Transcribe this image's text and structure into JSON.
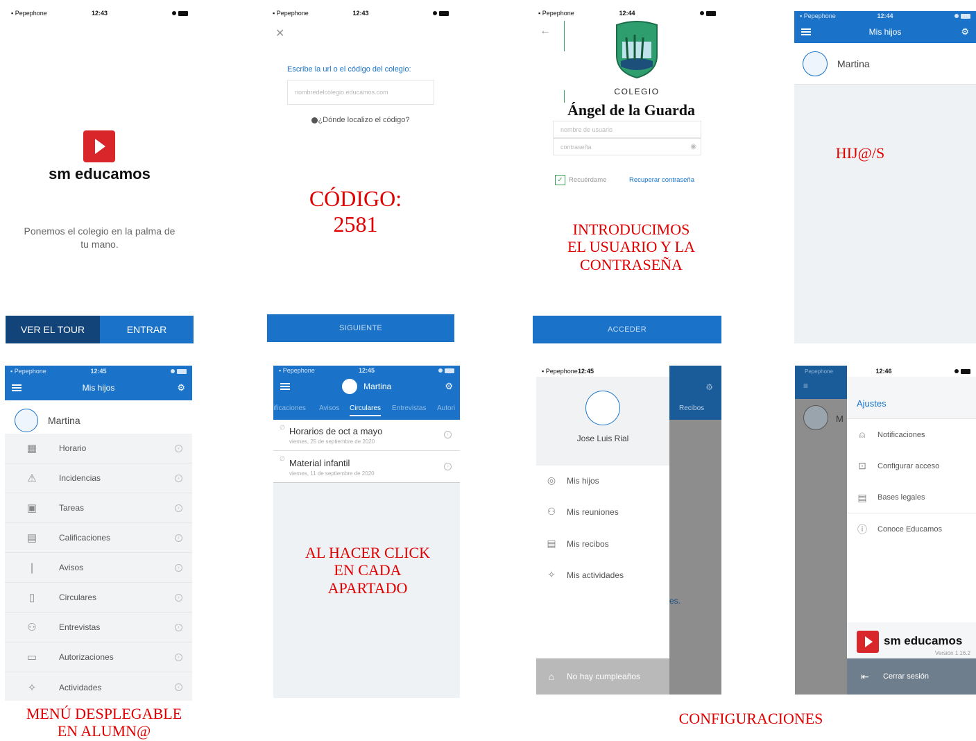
{
  "status": {
    "carrier": "Pepephone",
    "s1_time": "12:43",
    "s2_time": "12:43",
    "s3_time": "12:44",
    "s4_time": "12:44",
    "s5_time": "12:45",
    "s6_time": "12:45",
    "s7_time": "12:45",
    "s8_time": "12:46"
  },
  "s1": {
    "brand": "sm educamos",
    "tagline": "Ponemos el colegio en la palma de tu mano.",
    "tour_label": "VER EL TOUR",
    "enter_label": "ENTRAR"
  },
  "s2": {
    "close_glyph": "✕",
    "prompt": "Escribe la url o el código del colegio:",
    "url_placeholder": "nombredelcolegio.educamos.com",
    "help": "¿Dónde localizo el código?",
    "next_label": "SIGUIENTE",
    "note_line1": "CÓDIGO:",
    "note_line2": "2581"
  },
  "s3": {
    "back_glyph": "←",
    "school_small": "COLEGIO",
    "school_name": "Ángel de la Guarda",
    "user_placeholder": "nombre de usuario",
    "pass_placeholder": "contraseña",
    "remember": "Recuérdame",
    "recover": "Recuperar contraseña",
    "access_label": "ACCEDER",
    "note": [
      "INTRODUCIMOS",
      "EL USUARIO Y LA",
      "CONTRASEÑA"
    ]
  },
  "s4": {
    "title": "Mis hijos",
    "child": "Martina",
    "note": "HIJ@/S"
  },
  "s5": {
    "title": "Mis hijos",
    "child": "Martina",
    "items": [
      "Horario",
      "Incidencias",
      "Tareas",
      "Calificaciones",
      "Avisos",
      "Circulares",
      "Entrevistas",
      "Autorizaciones",
      "Actividades"
    ],
    "icons": [
      "calendar-icon",
      "warning-icon",
      "calculator-icon",
      "grades-icon",
      "notice-icon",
      "document-icon",
      "interviews-icon",
      "authorization-icon",
      "activities-icon"
    ],
    "note": [
      "MENÚ DESPLEGABLE",
      "EN ALUMN@"
    ]
  },
  "s6": {
    "child": "Martina",
    "tabs": [
      "lificaciones",
      "Avisos",
      "Circulares",
      "Entrevistas",
      "Autori"
    ],
    "active_tab": "Circulares",
    "items": [
      {
        "title": "Horarios de oct a mayo",
        "date": "viernes, 25 de septiembre de 2020"
      },
      {
        "title": "Material infantil",
        "date": "viernes, 11 de septiembre de 2020"
      }
    ],
    "note": [
      "AL HACER CLICK",
      "EN CADA",
      "APARTADO"
    ]
  },
  "s7": {
    "user": "Jose Luis Rial",
    "items": [
      "Mis hijos",
      "Mis reuniones",
      "Mis recibos",
      "Mis actividades"
    ],
    "birthdays": "No hay cumpleaños",
    "behind_tab": "Recibos",
    "behind_text": "es."
  },
  "s8": {
    "title": "Ajustes",
    "behind_initial": "M",
    "items": [
      "Notificaciones",
      "Configurar acceso",
      "Bases legales",
      "Conoce Educamos"
    ],
    "brand": "sm educamos",
    "version": "Versión 1.16.2",
    "logout": "Cerrar sesión"
  },
  "caption_config": "CONFIGURACIONES",
  "colors": {
    "accent": "#1a73c8",
    "note": "#e00000",
    "dark_button": "#12447a"
  }
}
